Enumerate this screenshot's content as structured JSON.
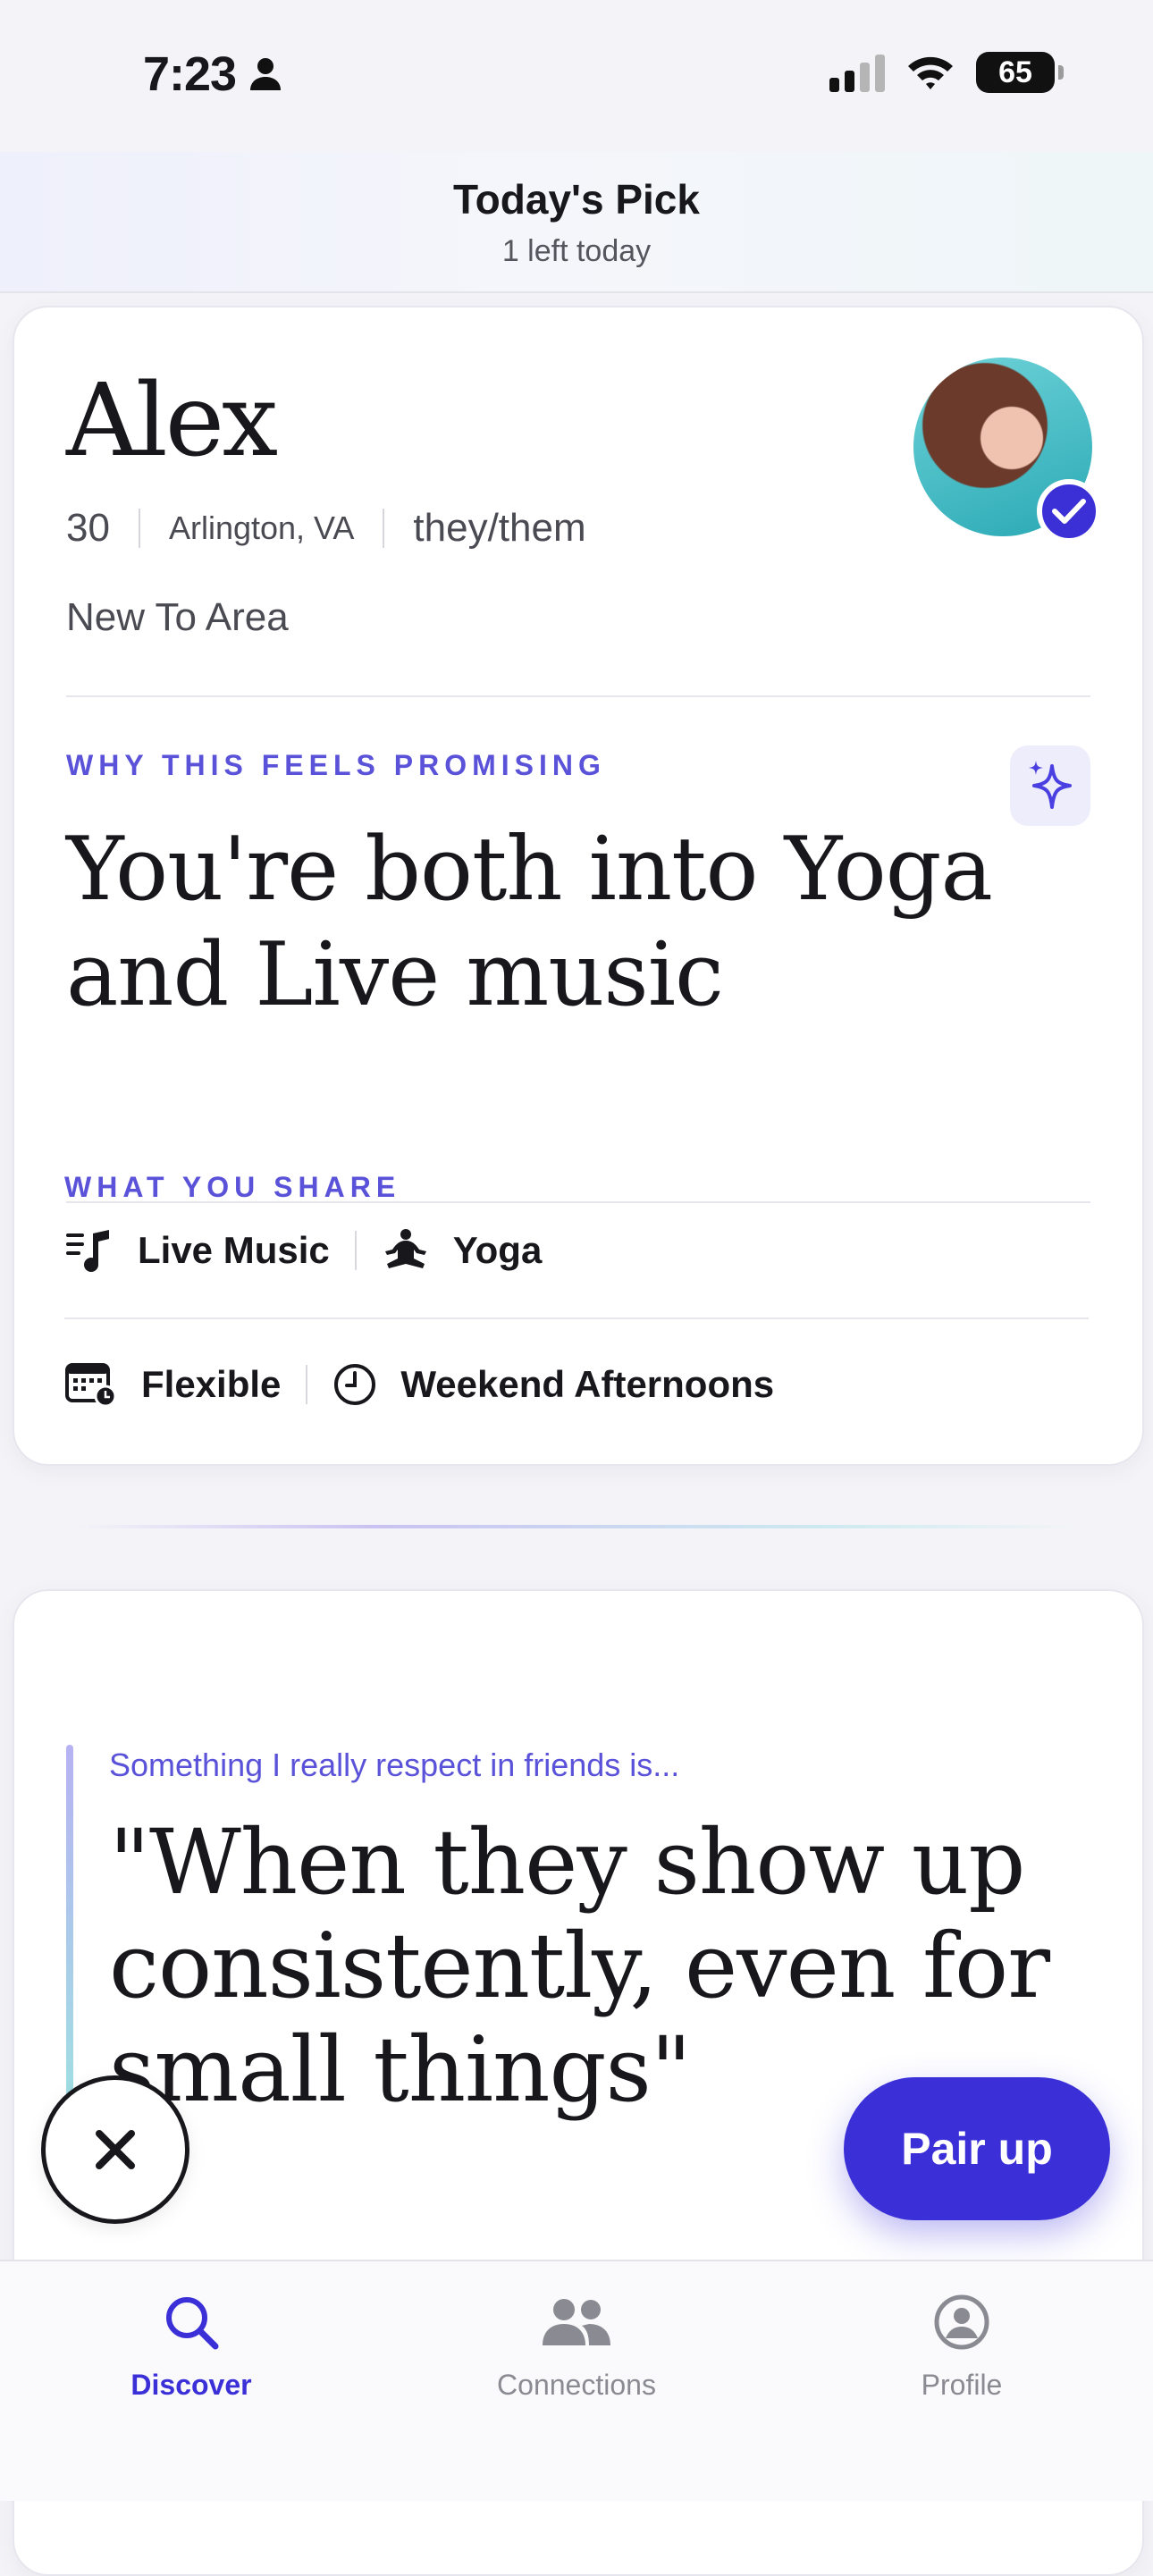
{
  "status_bar": {
    "time": "7:23",
    "battery": "65"
  },
  "header": {
    "title": "Today's Pick",
    "subtitle": "1 left today"
  },
  "profile": {
    "name": "Alex",
    "age": "30",
    "location": "Arlington, VA",
    "pronouns": "they/them",
    "tag": "New To Area",
    "verified": true
  },
  "promising": {
    "label": "WHY THIS FEELS PROMISING",
    "headline": "You're both into Yoga and Live music"
  },
  "share": {
    "label": "WHAT YOU SHARE",
    "interests": [
      {
        "icon": "music-note-icon",
        "label": "Live Music"
      },
      {
        "icon": "yoga-icon",
        "label": "Yoga"
      }
    ]
  },
  "availability": {
    "schedule": "Flexible",
    "time": "Weekend Afternoons"
  },
  "prompt": {
    "label": "Something I really respect in friends is...",
    "answer": "\"When they show up consistently, even for small things\""
  },
  "actions": {
    "pair_label": "Pair up"
  },
  "tabs": [
    {
      "label": "Discover",
      "icon": "search-icon",
      "active": true
    },
    {
      "label": "Connections",
      "icon": "people-icon",
      "active": false
    },
    {
      "label": "Profile",
      "icon": "profile-icon",
      "active": false
    }
  ],
  "colors": {
    "accent": "#3b30d8",
    "label": "#5a52d8"
  }
}
